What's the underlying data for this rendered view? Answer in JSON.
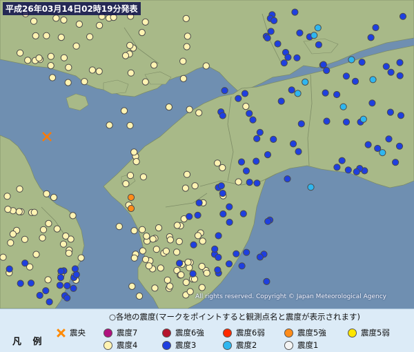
{
  "map": {
    "issue_title": "平成26年03月14日02時19分発表",
    "copyright": "All rights reserved. Copyright © Japan Meteorological Agency",
    "colors": {
      "sea": "#6f8fb1",
      "land": "#a8b988",
      "land_dark": "#8ea06e",
      "prefecture_border": "#7d8c66",
      "epicenter": "#ff7a00"
    },
    "epicenter": {
      "symbol": "x-mark",
      "color": "#ff7a00"
    },
    "stations": {
      "intensity_5_weak": 2,
      "intensity_4": 150,
      "intensity_3": 115,
      "intensity_2": 10
    }
  },
  "legend": {
    "heading": "凡 例",
    "caption": "○各地の震度(マークをポイントすると観測点名と震度が表示されます)",
    "items": [
      {
        "key": "epicenter",
        "label": "震央",
        "symbol": "x-mark",
        "color": "#ff7a00"
      },
      {
        "key": "int7",
        "label": "震度7",
        "color": "#b0127f"
      },
      {
        "key": "int6_strong",
        "label": "震度6強",
        "color": "#b5142c"
      },
      {
        "key": "int6_weak",
        "label": "震度6弱",
        "color": "#ff2a00"
      },
      {
        "key": "int5_strong",
        "label": "震度5強",
        "color": "#ff8c1a"
      },
      {
        "key": "int5_weak",
        "label": "震度5弱",
        "color": "#ffe600"
      },
      {
        "key": "int4",
        "label": "震度4",
        "color": "#fff3b2"
      },
      {
        "key": "int3",
        "label": "震度3",
        "color": "#1e3fe0"
      },
      {
        "key": "int2",
        "label": "震度2",
        "color": "#2fb6ef"
      },
      {
        "key": "int1",
        "label": "震度1",
        "color": "#f4f4f4"
      }
    ]
  }
}
